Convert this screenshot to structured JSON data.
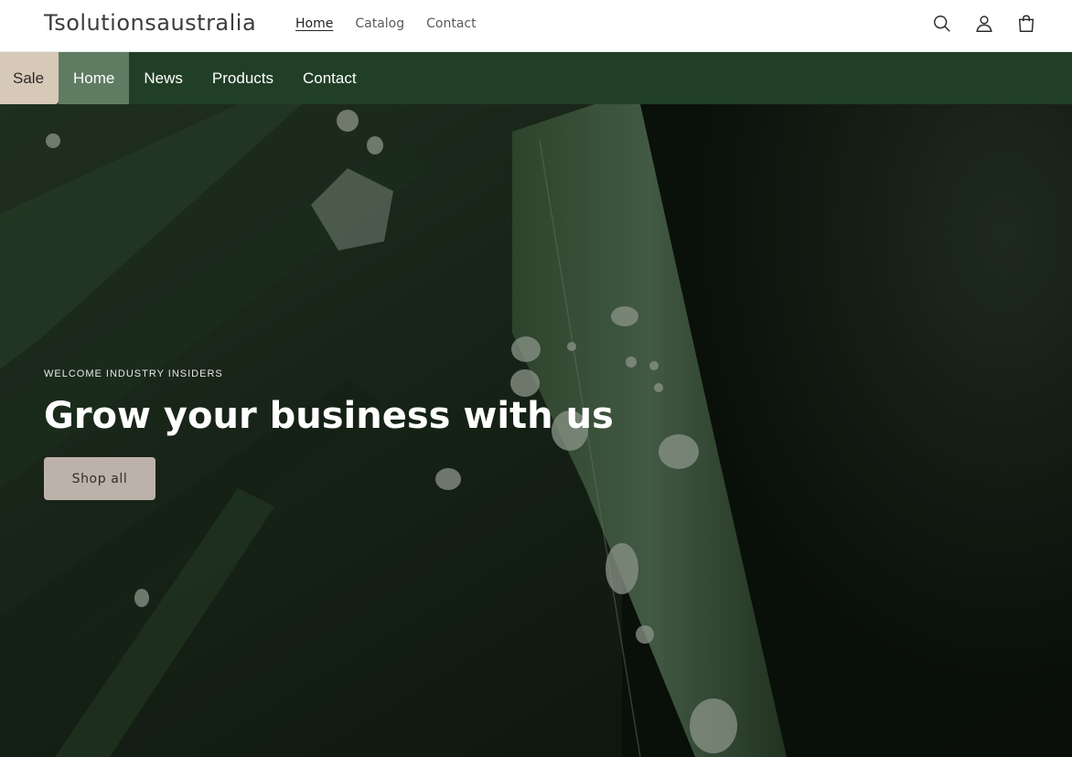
{
  "header": {
    "brand": "Tsolutionsaustralia",
    "nav": [
      {
        "label": "Home",
        "active": true
      },
      {
        "label": "Catalog",
        "active": false
      },
      {
        "label": "Contact",
        "active": false
      }
    ],
    "icons": [
      "search-icon",
      "account-icon",
      "cart-icon"
    ]
  },
  "mainnav": {
    "items": [
      {
        "label": "Sale"
      },
      {
        "label": "Home"
      },
      {
        "label": "News"
      },
      {
        "label": "Products"
      },
      {
        "label": "Contact"
      }
    ]
  },
  "hero": {
    "eyebrow": "WELCOME INDUSTRY INSIDERS",
    "headline": "Grow your business with us",
    "button_label": "Shop all"
  },
  "colors": {
    "nav_bar": "#213f26",
    "sale_tab": "#d7c9b7",
    "active_tab": "#5f7c63",
    "button": "#bdb2a9"
  }
}
